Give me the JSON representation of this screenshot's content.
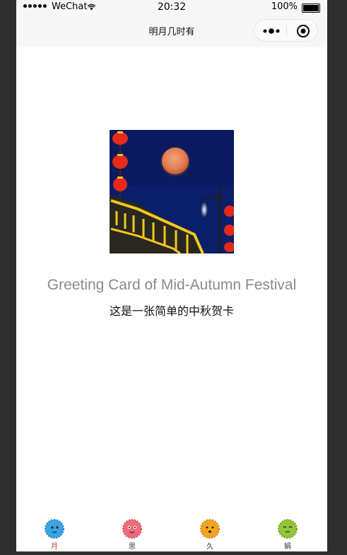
{
  "status_bar": {
    "carrier": "WeChat",
    "time": "20:32",
    "battery": "100%"
  },
  "nav": {
    "title": "明月几时有"
  },
  "card": {
    "image": "mid-autumn-moon-lanterns",
    "title": "Greeting Card of Mid-Autumn Festival",
    "subtitle": "这是一张简单的中秋贺卡"
  },
  "tabs": [
    {
      "label": "月",
      "icon": "blue-face-icon",
      "color": "#3aa3e3",
      "active": true
    },
    {
      "label": "思",
      "icon": "red-face-icon",
      "color": "#ef6b7a",
      "active": false
    },
    {
      "label": "久",
      "icon": "orange-face-icon",
      "color": "#f3a322",
      "active": false
    },
    {
      "label": "娟",
      "icon": "green-face-icon",
      "color": "#93c43a",
      "active": false
    }
  ],
  "colors": {
    "active_tab": "#c0392b",
    "title_gray": "#8a8a8a",
    "nav_bg": "#f7f7f7"
  }
}
